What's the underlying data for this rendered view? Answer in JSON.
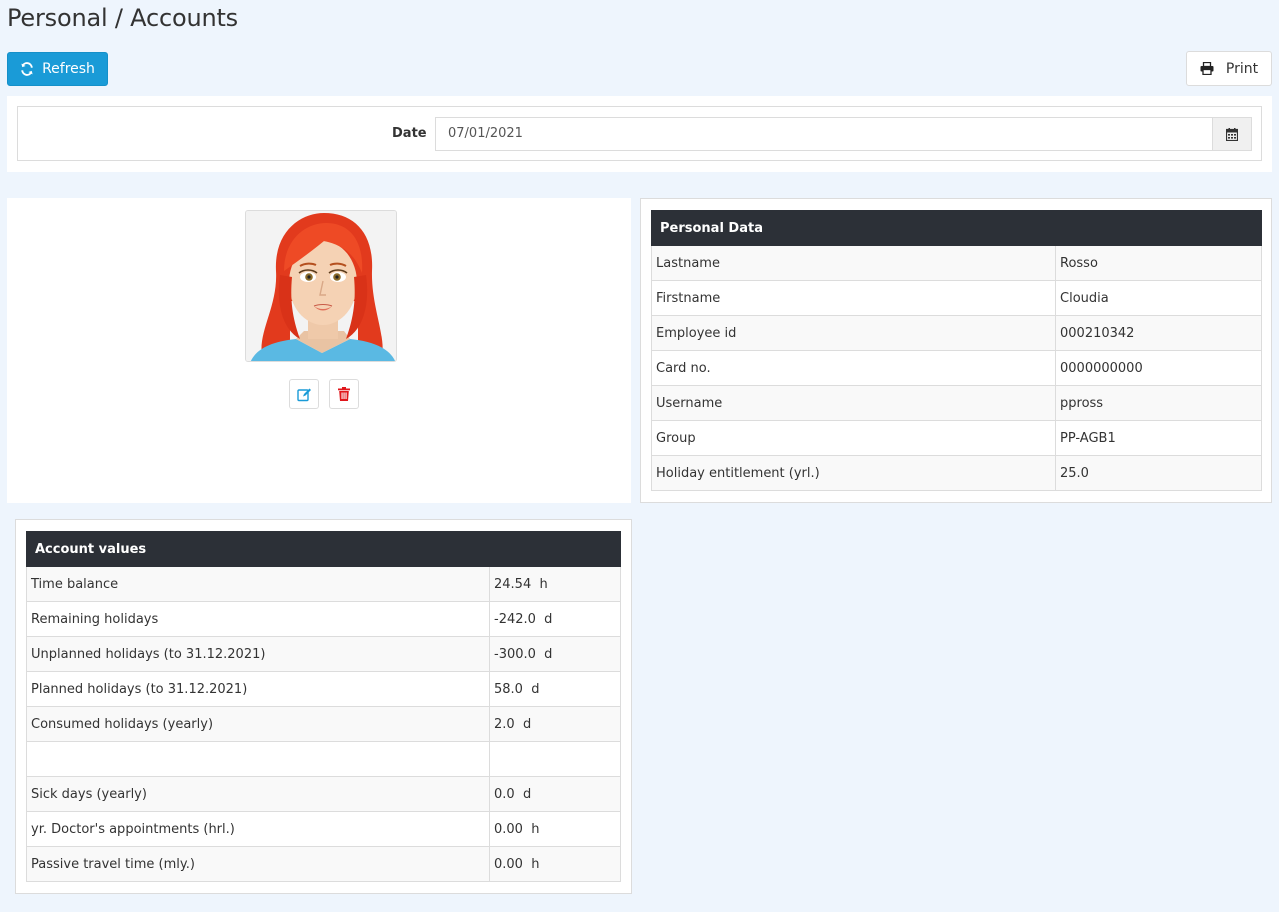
{
  "header": {
    "title": "Personal / Accounts",
    "refresh_label": "Refresh",
    "print_label": "Print"
  },
  "filter": {
    "date_label": "Date",
    "date_value": "07/01/2021"
  },
  "personal_data": {
    "title": "Personal Data",
    "rows": [
      {
        "label": "Lastname",
        "value": "Rosso"
      },
      {
        "label": "Firstname",
        "value": "Cloudia"
      },
      {
        "label": "Employee id",
        "value": "000210342"
      },
      {
        "label": "Card no.",
        "value": "0000000000"
      },
      {
        "label": "Username",
        "value": "ppross"
      },
      {
        "label": "Group",
        "value": "PP-AGB1"
      },
      {
        "label": "Holiday entitlement (yrl.)",
        "value": "25.0"
      }
    ]
  },
  "account_values": {
    "title": "Account values",
    "rows": [
      {
        "label": "Time balance",
        "value": "24.54  h"
      },
      {
        "label": "Remaining holidays",
        "value": "-242.0  d"
      },
      {
        "label": "Unplanned holidays (to 31.12.2021)",
        "value": "-300.0  d"
      },
      {
        "label": "Planned holidays (to 31.12.2021)",
        "value": "58.0  d"
      },
      {
        "label": "Consumed holidays (yearly)",
        "value": "2.0  d"
      },
      {
        "label": "",
        "value": ""
      },
      {
        "label": "Sick days (yearly)",
        "value": "0.0  d"
      },
      {
        "label": "yr. Doctor's appointments (hrl.)",
        "value": "0.00  h"
      },
      {
        "label": "Passive travel time (mly.)",
        "value": "0.00  h"
      }
    ]
  },
  "icons": {
    "refresh": "refresh-icon",
    "print": "print-icon",
    "calendar": "calendar-icon",
    "edit": "edit-icon",
    "delete": "trash-icon"
  },
  "colors": {
    "accent": "#1a9bd7",
    "table_header": "#2c3037",
    "delete": "#e0161b",
    "background": "#eef5fd"
  }
}
